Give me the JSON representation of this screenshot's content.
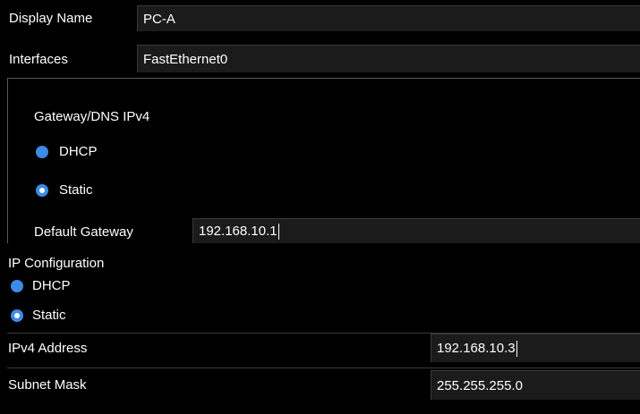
{
  "display_name": {
    "label": "Display Name",
    "value": "PC-A"
  },
  "interfaces": {
    "label": "Interfaces",
    "value": "FastEthernet0"
  },
  "gateway_dns": {
    "title": "Gateway/DNS IPv4",
    "dhcp_label": "DHCP",
    "static_label": "Static",
    "selected": "Static",
    "default_gateway_label": "Default Gateway",
    "default_gateway_value": "192.168.10.1"
  },
  "ip_config": {
    "title": "IP Configuration",
    "dhcp_label": "DHCP",
    "static_label": "Static",
    "selected": "Static",
    "ipv4_label": "IPv4 Address",
    "ipv4_value": "192.168.10.3",
    "subnet_label": "Subnet Mask",
    "subnet_value": "255.255.255.0"
  },
  "colors": {
    "radio": "#3d8be8",
    "field_bg": "#1b1b1b",
    "background": "#000000"
  }
}
